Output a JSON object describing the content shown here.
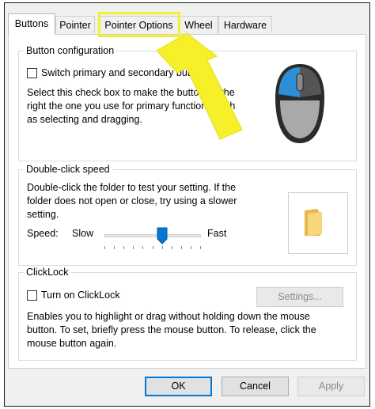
{
  "tabs": [
    {
      "label": "Buttons",
      "active": true
    },
    {
      "label": "Pointer",
      "active": false
    },
    {
      "label": "Pointer Options",
      "active": false
    },
    {
      "label": "Wheel",
      "active": false
    },
    {
      "label": "Hardware",
      "active": false
    }
  ],
  "button_configuration": {
    "title": "Button configuration",
    "checkbox_label": "Switch primary and secondary buttons",
    "checked": false,
    "description": [
      "Select this check box to make the button on the",
      "right the one you use for primary functions such",
      "as selecting and dragging."
    ]
  },
  "double_click": {
    "title": "Double-click speed",
    "description": [
      "Double-click the folder to test your setting. If the",
      "folder does not open or close, try using a slower",
      "setting."
    ],
    "speed_label": "Speed:",
    "slow_label": "Slow",
    "fast_label": "Fast",
    "speed_level": 0.6
  },
  "clicklock": {
    "title": "ClickLock",
    "checkbox_label": "Turn on ClickLock",
    "checked": false,
    "settings_label": "Settings...",
    "description": [
      "Enables you to highlight or drag without holding down the mouse",
      "button. To set, briefly press the mouse button. To release, click the",
      "mouse button again."
    ]
  },
  "footer": {
    "ok_label": "OK",
    "cancel_label": "Cancel",
    "apply_label": "Apply"
  },
  "colors": {
    "highlight": "#f5f02a",
    "accent": "#0078d7"
  }
}
